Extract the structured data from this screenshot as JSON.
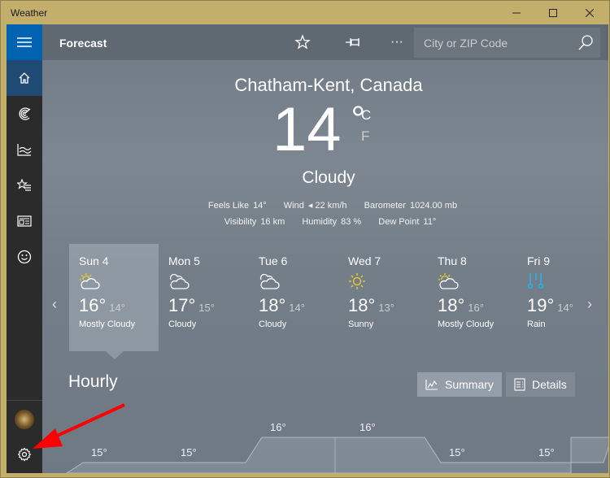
{
  "window": {
    "title": "Weather",
    "controls": {
      "minimize": "—",
      "maximize": "☐",
      "close": "✕"
    }
  },
  "sidebar": {
    "items": [
      {
        "name": "home",
        "icon": "home-icon"
      },
      {
        "name": "maps",
        "icon": "radar-icon"
      },
      {
        "name": "historical",
        "icon": "chart-icon"
      },
      {
        "name": "places",
        "icon": "favorites-list-icon"
      },
      {
        "name": "news",
        "icon": "news-icon"
      },
      {
        "name": "feedback",
        "icon": "smiley-icon"
      }
    ],
    "bottom": [
      {
        "name": "account",
        "icon": "avatar"
      },
      {
        "name": "settings",
        "icon": "gear-icon"
      }
    ]
  },
  "header": {
    "title": "Forecast",
    "more_label": "···",
    "search_placeholder": "City or ZIP Code",
    "search_value": ""
  },
  "current": {
    "location": "Chatham-Kent, Canada",
    "temperature": "14",
    "degree": "°",
    "unit_c": "C",
    "unit_f": "F",
    "condition": "Cloudy",
    "stats_row1": [
      {
        "label": "Feels Like",
        "value": "14°"
      },
      {
        "label": "Wind",
        "value": "◂ 22 km/h"
      },
      {
        "label": "Barometer",
        "value": "1024.00 mb"
      }
    ],
    "stats_row2": [
      {
        "label": "Visibility",
        "value": "16 km"
      },
      {
        "label": "Humidity",
        "value": "83 %"
      },
      {
        "label": "Dew Point",
        "value": "11°"
      }
    ]
  },
  "forecast": {
    "prev_arrow": "‹",
    "next_arrow": "›",
    "days": [
      {
        "day": "Sun 4",
        "icon": "partly-cloudy-icon",
        "high": "16°",
        "low": "14°",
        "condition": "Mostly Cloudy",
        "selected": true
      },
      {
        "day": "Mon 5",
        "icon": "cloudy-icon",
        "high": "17°",
        "low": "15°",
        "condition": "Cloudy"
      },
      {
        "day": "Tue 6",
        "icon": "cloudy-icon",
        "high": "18°",
        "low": "14°",
        "condition": "Cloudy"
      },
      {
        "day": "Wed 7",
        "icon": "sunny-icon",
        "high": "18°",
        "low": "13°",
        "condition": "Sunny"
      },
      {
        "day": "Thu 8",
        "icon": "partly-cloudy-icon",
        "high": "18°",
        "low": "16°",
        "condition": "Mostly Cloudy"
      },
      {
        "day": "Fri 9",
        "icon": "rain-icon",
        "high": "19°",
        "low": "14°",
        "condition": "Rain"
      }
    ]
  },
  "hourly": {
    "title": "Hourly",
    "summary_label": "Summary",
    "details_label": "Details",
    "temps": [
      "15°",
      "15°",
      "16°",
      "16°",
      "15°",
      "15°"
    ],
    "values": [
      15,
      15,
      16,
      16,
      15,
      15
    ]
  },
  "colors": {
    "accent": "#0063b1",
    "titlebar": "#c3ae6c",
    "sun": "#f2d21b",
    "rain": "#2bb0e6",
    "annotation_arrow": "#ff0000"
  }
}
